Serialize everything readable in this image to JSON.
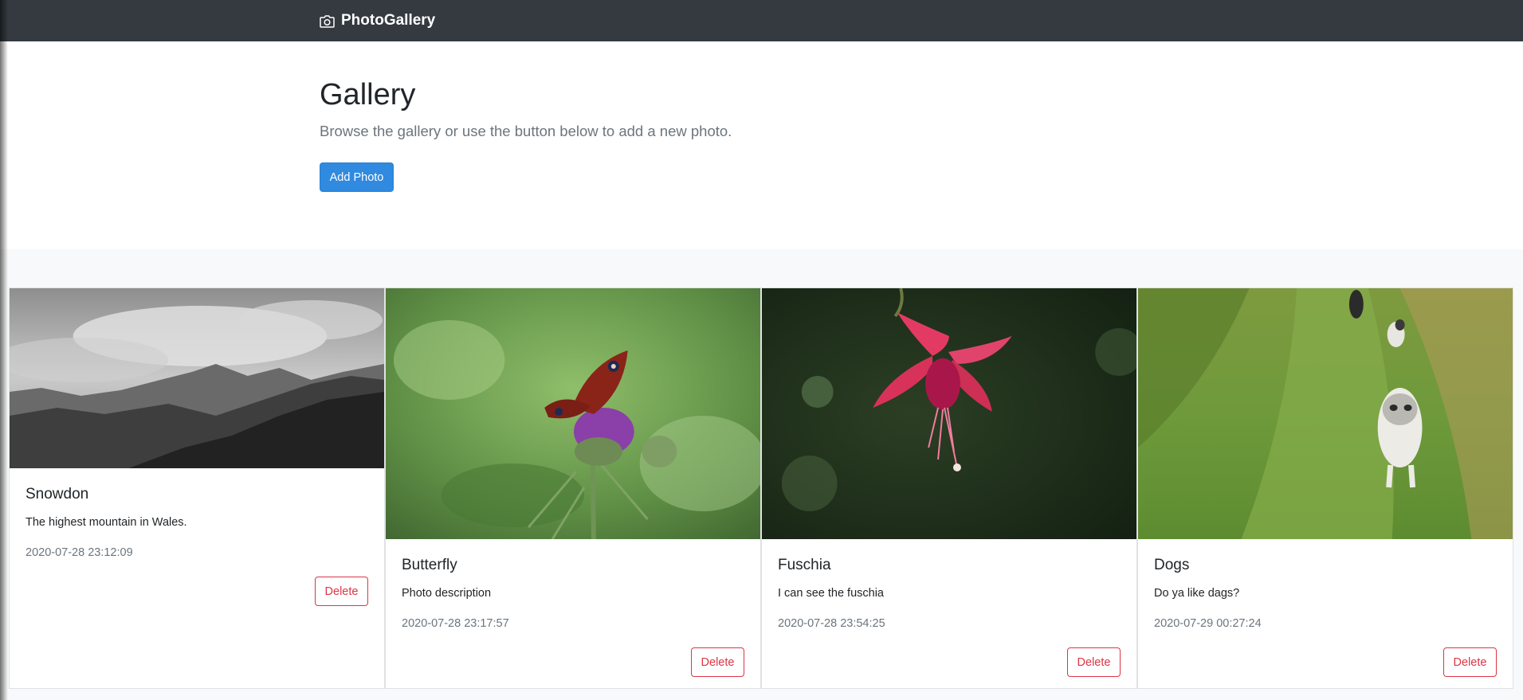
{
  "navbar": {
    "brand_icon": "camera-icon",
    "brand_label": "PhotoGallery"
  },
  "hero": {
    "title": "Gallery",
    "lead": "Browse the gallery or use the button below to add a new photo.",
    "add_button_label": "Add Photo"
  },
  "photos": [
    {
      "title": "Snowdon",
      "description": "The highest mountain in Wales.",
      "date": "2020-07-28 23:12:09",
      "delete_label": "Delete",
      "image_name": "mountain-photo"
    },
    {
      "title": "Butterfly",
      "description": "Photo description",
      "date": "2020-07-28 23:17:57",
      "delete_label": "Delete",
      "image_name": "butterfly-photo"
    },
    {
      "title": "Fuschia",
      "description": "I can see the fuschia",
      "date": "2020-07-28 23:54:25",
      "delete_label": "Delete",
      "image_name": "fuchsia-photo"
    },
    {
      "title": "Dogs",
      "description": "Do ya like dags?",
      "date": "2020-07-29 00:27:24",
      "delete_label": "Delete",
      "image_name": "dogs-photo"
    }
  ],
  "colors": {
    "navbar_bg": "#343a40",
    "primary": "#2f8ae0",
    "danger": "#dc3545",
    "muted": "#6c757d",
    "band_bg": "#f8f9fa"
  }
}
